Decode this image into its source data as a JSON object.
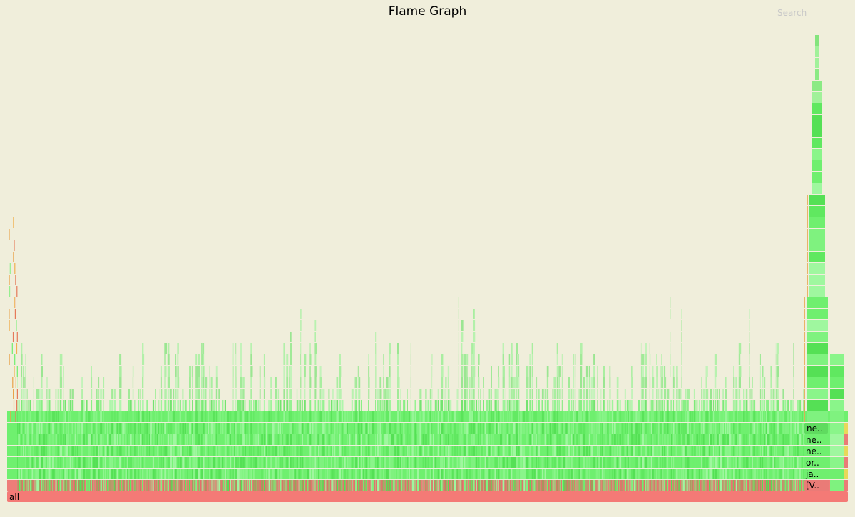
{
  "title": "Flame Graph",
  "search_label": "Search",
  "colors": {
    "background": "#f0eedb",
    "root_frame": "#f47a76",
    "kernel_frames": "#ea7b77",
    "jit_frames": "#6fef6f",
    "c_frames": "#e8b24a",
    "native_frames": "#e8d85a"
  },
  "frames": {
    "root": "all",
    "stack_labels": [
      "[V..",
      "ja..",
      "or..",
      "ne..",
      "ne..",
      "ne.."
    ]
  }
}
